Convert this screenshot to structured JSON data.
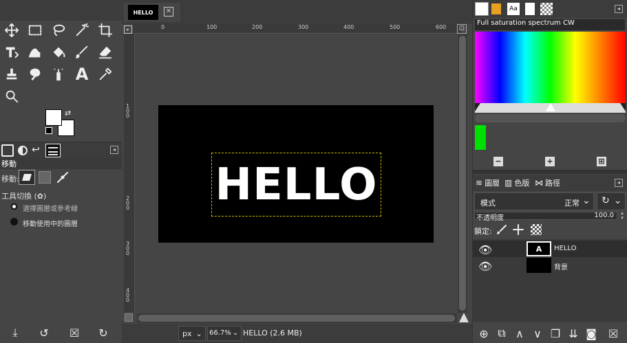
{
  "left_panel": {
    "tool_options_title": "移動",
    "move_label": "移動:",
    "tool_toggle_label": "工具切換 (✿)",
    "radio_pick": "選擇圖層或參考線",
    "radio_active": "移動使用中的圖層"
  },
  "image_tab": {
    "thumb_text": "HELLO"
  },
  "ruler": {
    "h_ticks": [
      "0",
      "100",
      "200",
      "300",
      "400",
      "500",
      "600"
    ],
    "v_ticks": [
      "1\n0\n0",
      "2\n0\n0",
      "3\n0\n0",
      "4\n0\n0"
    ]
  },
  "canvas": {
    "text": "HELLO",
    "bg_color": "#000000",
    "text_color": "#ffffff"
  },
  "status_bar": {
    "unit": "px",
    "zoom": "66.7%",
    "info": "HELLO (2.6 MB)"
  },
  "right_panel": {
    "gradient_name": "Full saturation spectrum CW",
    "fg_swatch_color": "#00e000",
    "layers_tab": "圖層",
    "channels_tab": "色版",
    "paths_tab": "路徑",
    "mode_label": "模式",
    "mode_value": "正常",
    "opacity_label": "不透明度",
    "opacity_value": "100.0",
    "lock_label": "鎖定:",
    "layers": [
      {
        "name": "HELLO"
      },
      {
        "name": "背景"
      }
    ]
  }
}
